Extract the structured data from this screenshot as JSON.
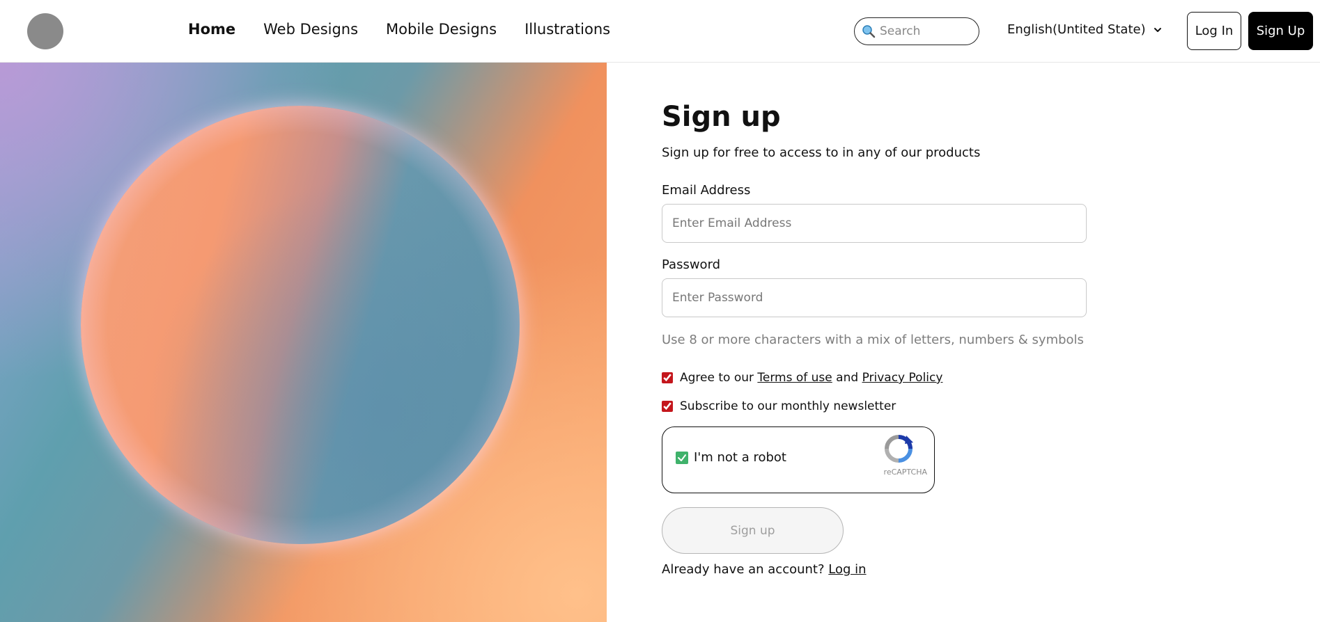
{
  "header": {
    "nav": [
      {
        "label": "Home",
        "active": true
      },
      {
        "label": "Web Designs",
        "active": false
      },
      {
        "label": "Mobile Designs",
        "active": false
      },
      {
        "label": "Illustrations",
        "active": false
      }
    ],
    "search_placeholder": "Search",
    "language": "English(Untited State)",
    "login_label": "Log In",
    "signup_label": "Sign Up"
  },
  "form": {
    "title": "Sign up",
    "subtitle": "Sign up for free to access to in any of our products",
    "email_label": "Email Address",
    "email_placeholder": "Enter Email Address",
    "email_value": "",
    "password_label": "Password",
    "password_placeholder": "Enter Password",
    "password_value": "",
    "password_hint": "Use 8 or more characters with a mix of letters, numbers & symbols",
    "agree_prefix": "Agree to our",
    "terms_link": "Terms of use",
    "agree_and": "and",
    "privacy_link": "Privacy Policy",
    "agree_checked": true,
    "newsletter_label": "Subscribe to our monthly newsletter",
    "newsletter_checked": true,
    "captcha_label": "I'm not a robot",
    "captcha_brand": "reCAPTCHA",
    "submit_label": "Sign up",
    "already_text": "Already have an account?",
    "login_link": "Log in"
  },
  "colors": {
    "accent_black": "#000000",
    "checkbox_red": "#c4161c",
    "captcha_green": "#3fb26b",
    "hint_gray": "#7d7d7d"
  }
}
